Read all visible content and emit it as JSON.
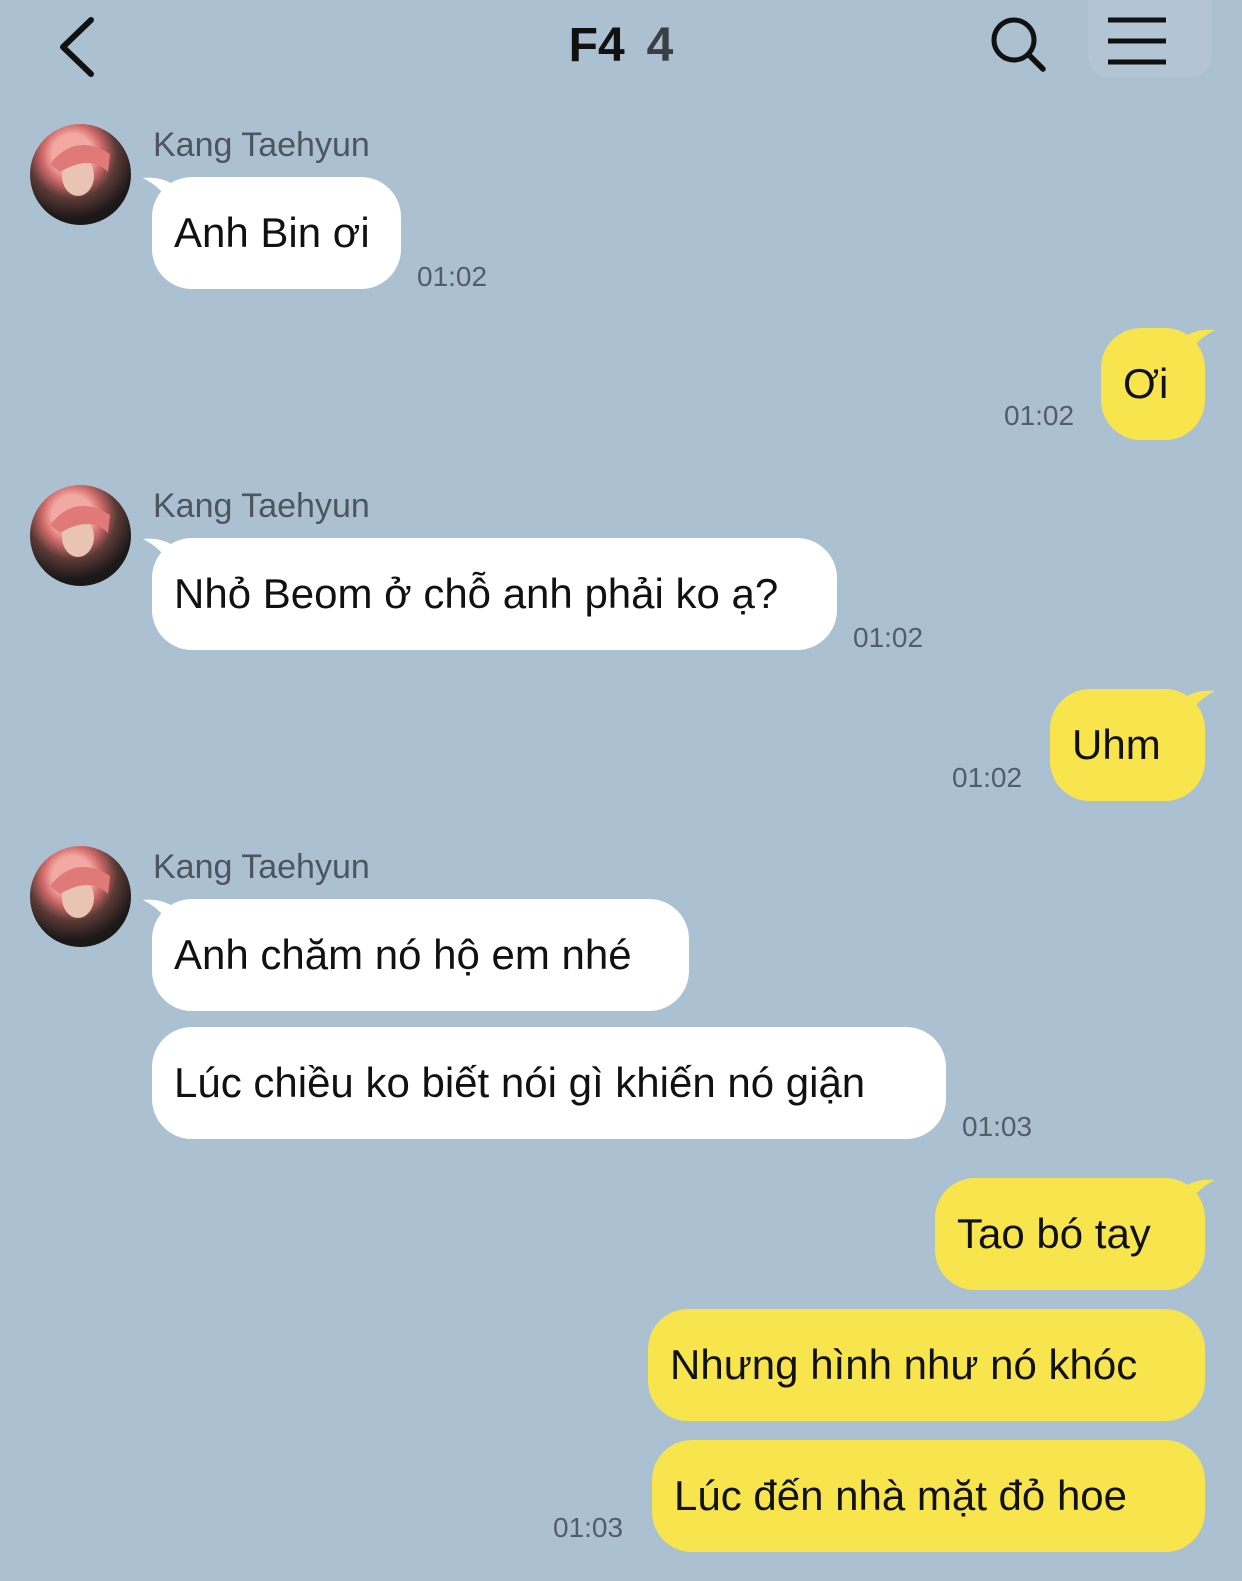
{
  "header": {
    "title": "F4",
    "member_count": "4",
    "back_icon": "chevron-left-icon",
    "search_icon": "search-icon",
    "menu_icon": "menu-icon"
  },
  "colors": {
    "background": "#abc1d1",
    "incoming_bubble": "#ffffff",
    "outgoing_bubble": "#f8e54e"
  },
  "messages": [
    {
      "sender": "Kang Taehyun",
      "text": "Anh Bin ơi",
      "time": "01:02"
    },
    {
      "text": "Ơi",
      "time": "01:02"
    },
    {
      "sender": "Kang Taehyun",
      "text": "Nhỏ Beom ở chỗ anh phải ko ạ?",
      "time": "01:02"
    },
    {
      "text": "Uhm",
      "time": "01:02"
    },
    {
      "sender": "Kang Taehyun",
      "text": "Anh chăm nó hộ em nhé"
    },
    {
      "text": "Lúc chiều ko biết nói gì khiến nó giận",
      "time": "01:03"
    },
    {
      "text": "Tao bó tay"
    },
    {
      "text": "Nhưng hình như nó khóc"
    },
    {
      "text": "Lúc đến nhà mặt đỏ hoe",
      "time": "01:03"
    }
  ]
}
